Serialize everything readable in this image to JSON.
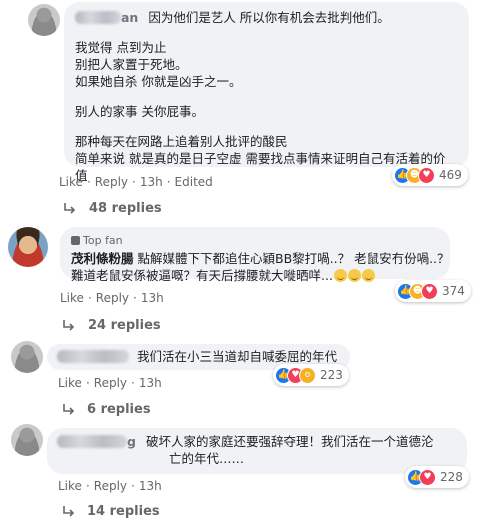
{
  "comments": [
    {
      "author_fragment": "an",
      "lines": [
        "因为他们是艺人 所以你有机会去批判他们。",
        "我觉得 点到为止",
        "别把人家置于死地。",
        "如果她自杀 你就是凶手之一。",
        "别人的家事 关你屁事。",
        "那种每天在网路上追着别人批评的酸民",
        "简单来说 就是真的是日子空虚 需要找点事情来证明自己有活着的价",
        "值"
      ],
      "actions": {
        "like": "Like",
        "reply": "Reply",
        "time": "13h",
        "edited": "Edited"
      },
      "reaction_count": "469",
      "reactions": [
        "like-icon",
        "haha-icon",
        "love-icon"
      ],
      "replies": "48 replies"
    },
    {
      "badge": "Top fan",
      "author": "茂利條粉腸",
      "lines": [
        "點解媒體下下都追住心穎BB黎打喎..？ 老鼠安冇份喎..？",
        "難道老鼠安係被逼嘅？有天后撐腰就大嘥晒咩..."
      ],
      "actions": {
        "like": "Like",
        "reply": "Reply",
        "time": "13h"
      },
      "reaction_count": "374",
      "reactions": [
        "like-icon",
        "haha-icon",
        "love-icon"
      ],
      "replies": "24 replies"
    },
    {
      "lines": [
        "我们活在小三当道却自喊委屈的年代"
      ],
      "actions": {
        "like": "Like",
        "reply": "Reply",
        "time": "13h"
      },
      "reaction_count": "223",
      "reactions": [
        "like-icon",
        "love-icon",
        "wow-icon"
      ],
      "replies": "6 replies"
    },
    {
      "author_fragment": "g",
      "lines": [
        "破坏人家的家庭还要强辞夺理！我们活在一个道德沦",
        "亡的年代……"
      ],
      "actions": {
        "like": "Like",
        "reply": "Reply",
        "time": "13h"
      },
      "reaction_count": "228",
      "reactions": [
        "like-icon",
        "love-icon"
      ],
      "replies": "14 replies"
    }
  ]
}
